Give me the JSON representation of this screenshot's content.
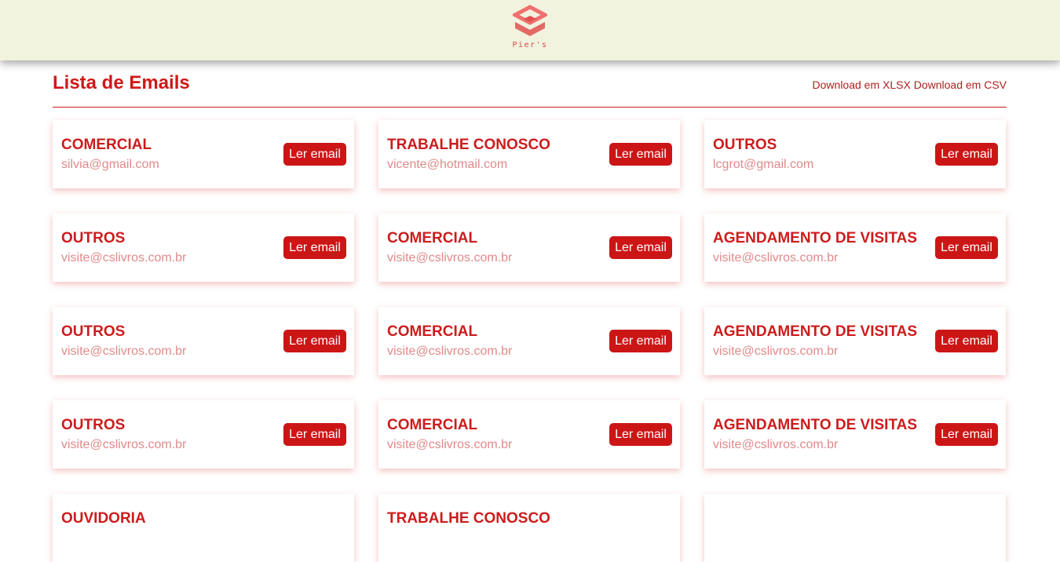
{
  "header": {
    "logo_text": "Pier's"
  },
  "page": {
    "title": "Lista de Emails",
    "download_xlsx": "Download em XLSX",
    "download_csv": "Download em CSV"
  },
  "colors": {
    "accent": "#cc1616",
    "header_bg": "#f2f3de",
    "email_text": "#e08a8a"
  },
  "emails": [
    {
      "subject": "COMERCIAL",
      "email": "silvia@gmail.com",
      "button": "Ler email"
    },
    {
      "subject": "TRABALHE CONOSCO",
      "email": "vicente@hotmail.com",
      "button": "Ler email"
    },
    {
      "subject": "OUTROS",
      "email": "lcgrot@gmail.com",
      "button": "Ler email"
    },
    {
      "subject": "OUTROS",
      "email": "visite@cslivros.com.br",
      "button": "Ler email"
    },
    {
      "subject": "COMERCIAL",
      "email": "visite@cslivros.com.br",
      "button": "Ler email"
    },
    {
      "subject": "AGENDAMENTO DE VISITAS",
      "email": "visite@cslivros.com.br",
      "button": "Ler email"
    },
    {
      "subject": "OUTROS",
      "email": "visite@cslivros.com.br",
      "button": "Ler email"
    },
    {
      "subject": "COMERCIAL",
      "email": "visite@cslivros.com.br",
      "button": "Ler email"
    },
    {
      "subject": "AGENDAMENTO DE VISITAS",
      "email": "visite@cslivros.com.br",
      "button": "Ler email"
    },
    {
      "subject": "OUTROS",
      "email": "visite@cslivros.com.br",
      "button": "Ler email"
    },
    {
      "subject": "COMERCIAL",
      "email": "visite@cslivros.com.br",
      "button": "Ler email"
    },
    {
      "subject": "AGENDAMENTO DE VISITAS",
      "email": "visite@cslivros.com.br",
      "button": "Ler email"
    },
    {
      "subject": "OUVIDORIA",
      "email": "",
      "button": ""
    },
    {
      "subject": "TRABALHE CONOSCO",
      "email": "",
      "button": ""
    },
    {
      "subject": "",
      "email": "",
      "button": ""
    }
  ]
}
